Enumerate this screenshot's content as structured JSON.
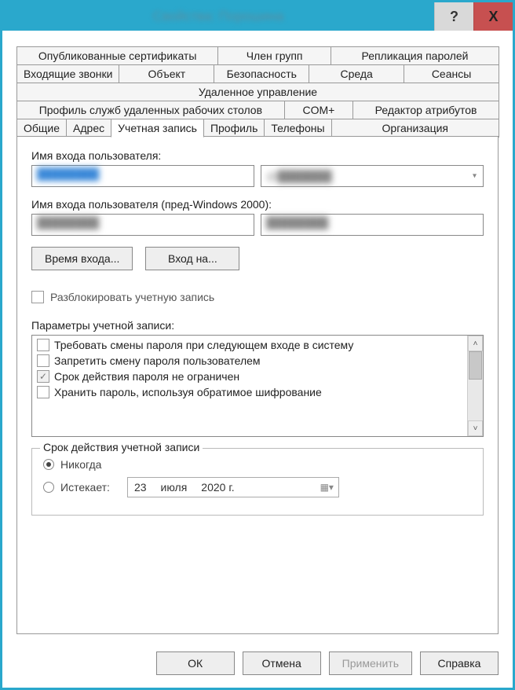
{
  "title": "Свойства: Порошина",
  "tabs": {
    "row1": [
      "Опубликованные сертификаты",
      "Член групп",
      "Репликация паролей"
    ],
    "row2": [
      "Входящие звонки",
      "Объект",
      "Безопасность",
      "Среда",
      "Сеансы"
    ],
    "row3": [
      "Удаленное управление"
    ],
    "row4": [
      "Профиль служб удаленных рабочих столов",
      "COM+",
      "Редактор атрибутов"
    ],
    "row5": [
      "Общие",
      "Адрес",
      "Учетная запись",
      "Профиль",
      "Телефоны",
      "Организация"
    ]
  },
  "account": {
    "logon_label": "Имя входа пользователя:",
    "logon_value": "████████",
    "domain_value": "@███████",
    "prew2k_label": "Имя входа пользователя (пред-Windows 2000):",
    "prew2k_domain": "████████",
    "prew2k_user": "████████",
    "logon_hours_btn": "Время входа...",
    "logon_to_btn": "Вход на...",
    "unlock_label": "Разблокировать учетную запись",
    "options_label": "Параметры учетной записи:",
    "options": [
      {
        "label": "Требовать смены пароля при следующем входе в систему",
        "checked": false
      },
      {
        "label": "Запретить смену пароля пользователем",
        "checked": false
      },
      {
        "label": "Срок действия пароля не ограничен",
        "checked": true
      },
      {
        "label": "Хранить пароль, используя обратимое шифрование",
        "checked": false
      }
    ],
    "expiry": {
      "group_label": "Срок действия учетной записи",
      "never_label": "Никогда",
      "expires_label": "Истекает:",
      "date_day": "23",
      "date_month": "июля",
      "date_year": "2020 г."
    }
  },
  "buttons": {
    "ok": "ОК",
    "cancel": "Отмена",
    "apply": "Применить",
    "help": "Справка"
  }
}
